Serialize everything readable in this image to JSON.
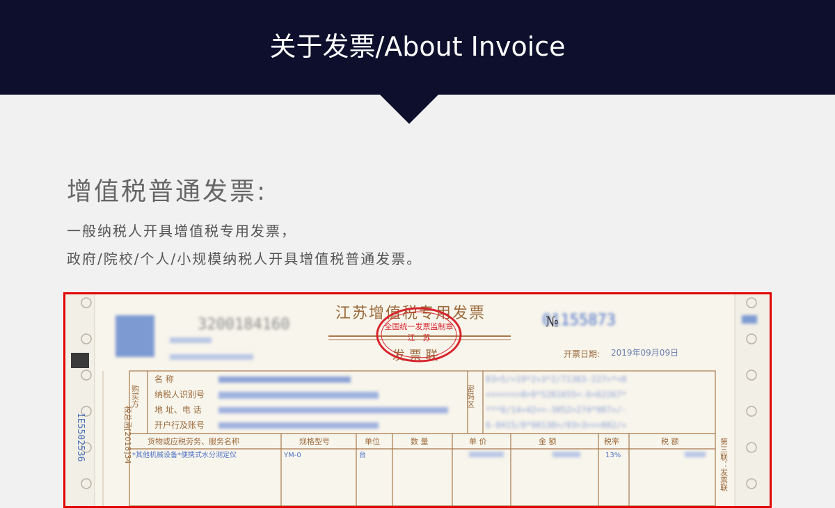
{
  "banner": {
    "title": "关于发票/About Invoice"
  },
  "section": {
    "heading": "增值税普通发票:",
    "line1": "一般纳税人开具增值税专用发票，",
    "line2": "政府/院校/个人/小规模纳税人开具增值税普通发票。"
  },
  "invoice": {
    "title": "江苏增值税专用发票",
    "copy_label": "发 票 联",
    "issue_date_label": "开票日期:",
    "issue_date": "2019年09月09日",
    "buyer_side_label": "购买方",
    "buyer_fields": [
      "名  称",
      "纳税人识别号",
      "地 址、电 话",
      "开户行及账号"
    ],
    "cipher_side_label": "密码区",
    "cipher_lines": [
      "03>5/>19*2+3*2/71363-227>*<0",
      "<<<<<<>0>9*5281655<-6<62267*",
      "***0/14+42<<-3852>274*907+/-",
      "6-0415/8*90138>/03>3>>>882/+"
    ],
    "columns": [
      "货物或应税劳务、服务名称",
      "规格型号",
      "单位",
      "数 量",
      "单 价",
      "金 额",
      "税率",
      "税 额"
    ],
    "row1_name": "*其他机械设备*便携式水分测定仪",
    "row1_spec": "YM-0",
    "row1_unit": "台",
    "row1_rate": "13%",
    "right_side_label": "第三联：发票联",
    "left_side_label": "税总函[2018]34",
    "stamp_text": "全国统一发票监制章",
    "no_symbol": "№"
  },
  "colors": {
    "banner_bg": "#0d0f2d",
    "highlight_border": "#e00000",
    "invoice_ink": "#a9774a",
    "stamp_red": "#d8242c",
    "print_blue": "#3c63c8"
  }
}
